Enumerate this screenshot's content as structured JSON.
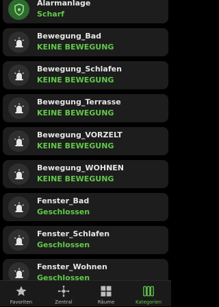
{
  "items": [
    {
      "title": "Alarmanlage",
      "value": "Scharf",
      "icon": "shield-icon"
    },
    {
      "title": "Bewegung_Bad",
      "value": "KEINE BEWEGUNG",
      "icon": "alarm-light-icon"
    },
    {
      "title": "Bewegung_Schlafen",
      "value": "KEINE BEWEGUNG",
      "icon": "alarm-light-icon"
    },
    {
      "title": "Bewegung_Terrasse",
      "value": "KEINE BEWEGUNG",
      "icon": "alarm-light-icon"
    },
    {
      "title": "Bewegung_VORZELT",
      "value": "KEINE BEWEGUNG",
      "icon": "alarm-light-icon"
    },
    {
      "title": "Bewegung_WOHNEN",
      "value": "KEINE BEWEGUNG",
      "icon": "alarm-light-icon"
    },
    {
      "title": "Fenster_Bad",
      "value": "Geschlossen",
      "icon": "alarm-light-icon"
    },
    {
      "title": "Fenster_Schlafen",
      "value": "Geschlossen",
      "icon": "alarm-light-icon"
    },
    {
      "title": "Fenster_Wohnen",
      "value": "Geschlossen",
      "icon": "alarm-light-icon"
    }
  ],
  "tabs": [
    {
      "label": "Favoriten",
      "icon": "star-icon",
      "active": false
    },
    {
      "label": "Zentral",
      "icon": "hub-icon",
      "active": false
    },
    {
      "label": "Räume",
      "icon": "rooms-grid-icon",
      "active": false
    },
    {
      "label": "Kategorien",
      "icon": "categories-icon",
      "active": true
    }
  ],
  "colors": {
    "background": "#000000",
    "card": "#1d1d1d",
    "accent": "#62c94a",
    "text": "#e6e6e6"
  }
}
